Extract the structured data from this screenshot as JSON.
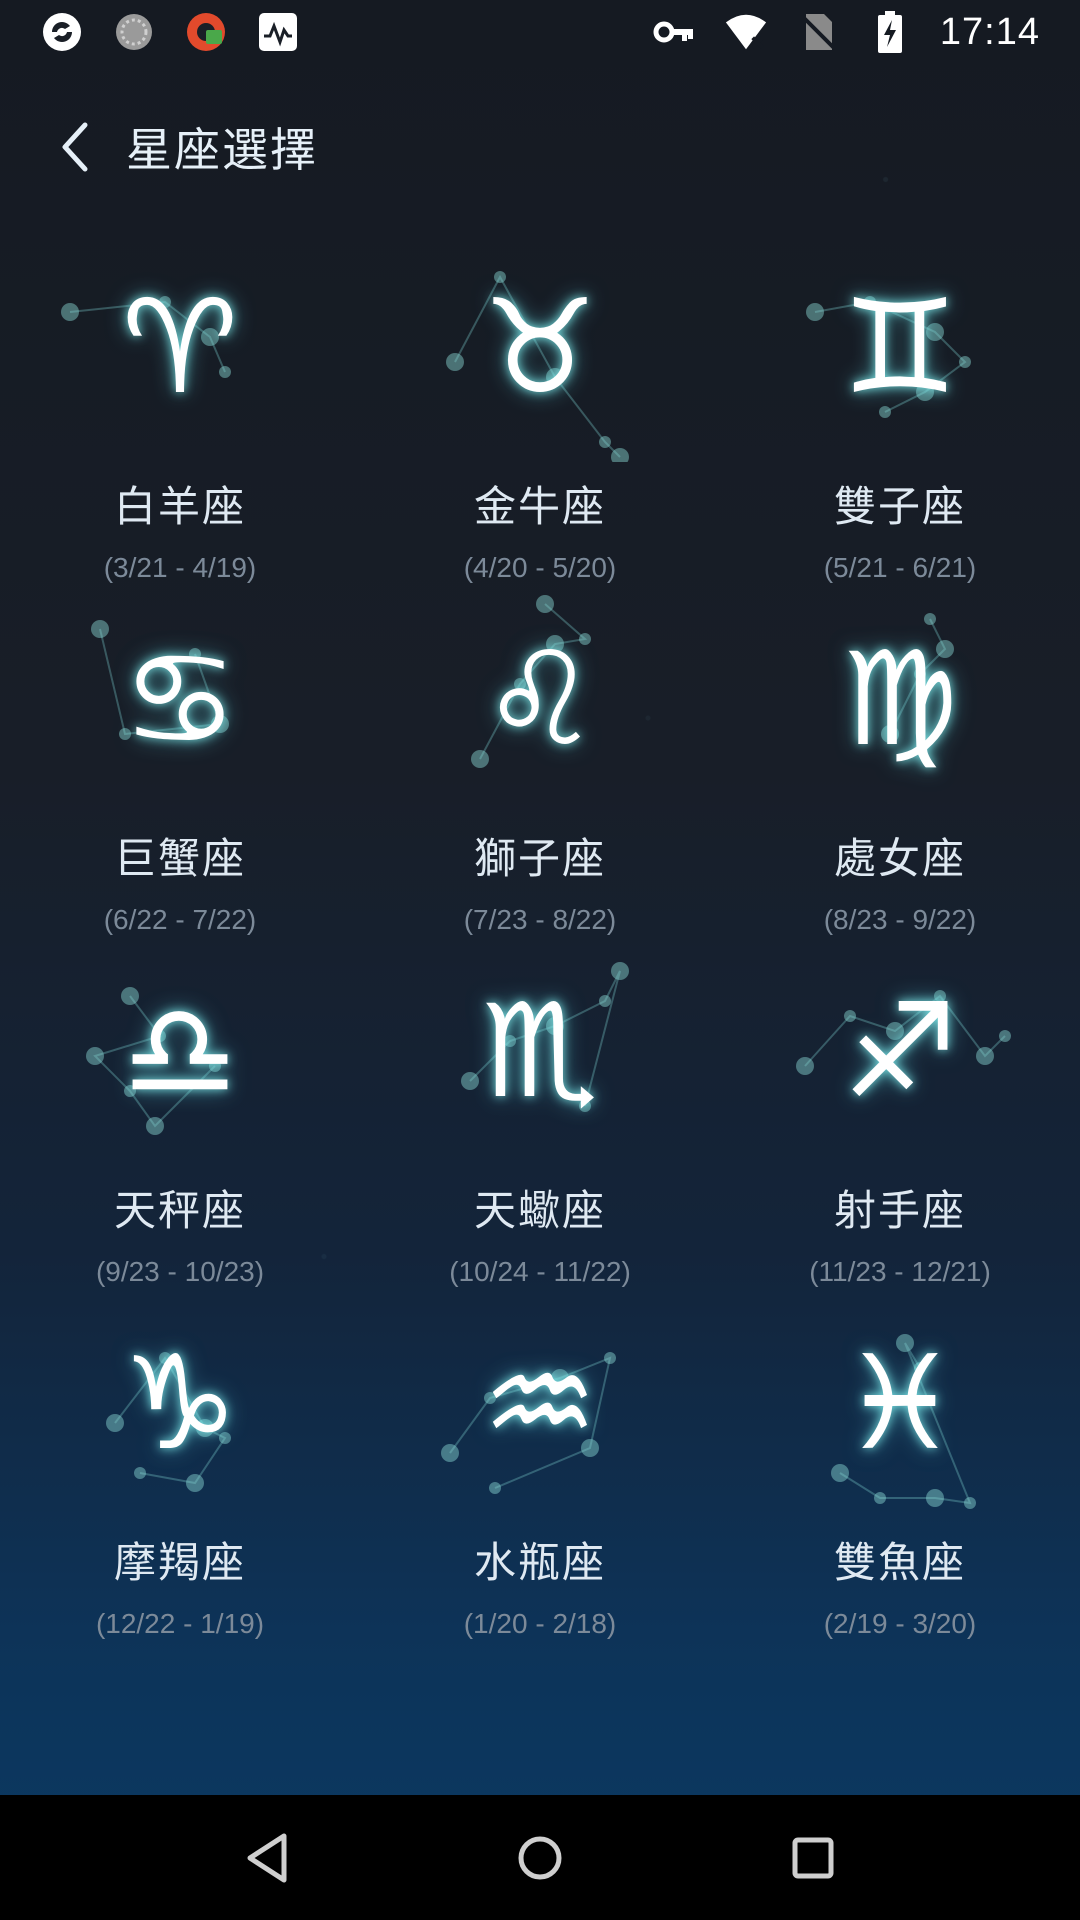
{
  "status_bar": {
    "time": "17:14",
    "left_icons": [
      "app-notification-icon",
      "loading-notification-icon",
      "vpn-app-notification-icon",
      "activity-notification-icon"
    ],
    "right_icons": [
      "vpn-key-icon",
      "wifi-no-internet-icon",
      "no-sim-icon",
      "battery-charging-icon"
    ]
  },
  "header": {
    "title": "星座選擇",
    "back_icon": "chevron-left-icon"
  },
  "zodiac": [
    {
      "id": "aries",
      "symbol": "♈",
      "name": "白羊座",
      "dates": "(3/21 - 4/19)"
    },
    {
      "id": "taurus",
      "symbol": "♉",
      "name": "金牛座",
      "dates": "(4/20 - 5/20)"
    },
    {
      "id": "gemini",
      "symbol": "♊",
      "name": "雙子座",
      "dates": "(5/21 - 6/21)"
    },
    {
      "id": "cancer",
      "symbol": "♋",
      "name": "巨蟹座",
      "dates": "(6/22 - 7/22)"
    },
    {
      "id": "leo",
      "symbol": "♌",
      "name": "獅子座",
      "dates": "(7/23 - 8/22)"
    },
    {
      "id": "virgo",
      "symbol": "♍",
      "name": "處女座",
      "dates": "(8/23 - 9/22)"
    },
    {
      "id": "libra",
      "symbol": "♎",
      "name": "天秤座",
      "dates": "(9/23 - 10/23)"
    },
    {
      "id": "scorpio",
      "symbol": "♏",
      "name": "天蠍座",
      "dates": "(10/24 - 11/22)"
    },
    {
      "id": "sagittarius",
      "symbol": "♐",
      "name": "射手座",
      "dates": "(11/23 - 12/21)"
    },
    {
      "id": "capricorn",
      "symbol": "♑",
      "name": "摩羯座",
      "dates": "(12/22 - 1/19)"
    },
    {
      "id": "aquarius",
      "symbol": "♒",
      "name": "水瓶座",
      "dates": "(1/20 - 2/18)"
    },
    {
      "id": "pisces",
      "symbol": "♓",
      "name": "雙魚座",
      "dates": "(2/19 - 3/20)"
    }
  ],
  "nav_bar": {
    "buttons": [
      "back-triangle-icon",
      "home-circle-icon",
      "recents-square-icon"
    ]
  },
  "colors": {
    "glow": "#8cf0f0",
    "title_text": "#e6f0f8",
    "date_text": "#7c8a99",
    "background_top": "#151a22",
    "background_bottom": "#0a3a64"
  }
}
